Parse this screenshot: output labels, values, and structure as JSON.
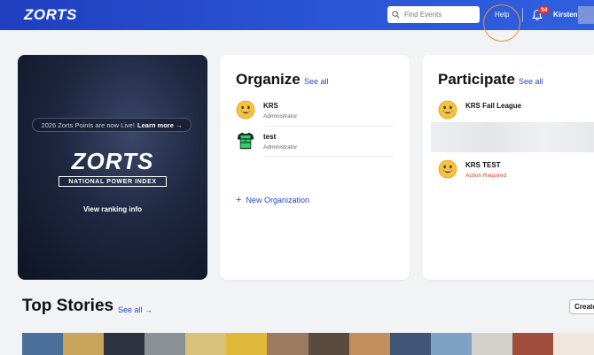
{
  "header": {
    "logo": "ZORTS",
    "search_placeholder": "Find Events",
    "help_label": "Help",
    "notification_count": "34",
    "user_name": "Kirsten"
  },
  "promo": {
    "pill_text": "2026 Zorts Points are now Live!",
    "pill_link": "Learn more →",
    "logo": "ZORTS",
    "subtitle": "NATIONAL POWER INDEX",
    "button_label": "View ranking info"
  },
  "organize": {
    "title": "Organize",
    "see_all": "See all",
    "items": [
      {
        "name": "KRS",
        "role": "Administrator",
        "icon": "smiley-icon"
      },
      {
        "name": "test",
        "role": "Administrator",
        "icon": "jersey-icon"
      }
    ],
    "new_label": "New Organization"
  },
  "participate": {
    "title": "Participate",
    "see_all": "See all",
    "items": [
      {
        "name": "KRS Fall League",
        "role": "",
        "icon": "smiley-icon"
      },
      {
        "name": "KRS TEST",
        "role": "Action Required",
        "icon": "smiley-icon"
      }
    ]
  },
  "stories": {
    "title": "Top Stories",
    "see_all": "See all →",
    "create_label": "Create"
  },
  "colors": {
    "header_blue": "#2b55d6",
    "link_blue": "#2548c9",
    "warning": "#d2421e",
    "badge_red": "#e0342b",
    "highlight_ring": "#e8923a"
  }
}
